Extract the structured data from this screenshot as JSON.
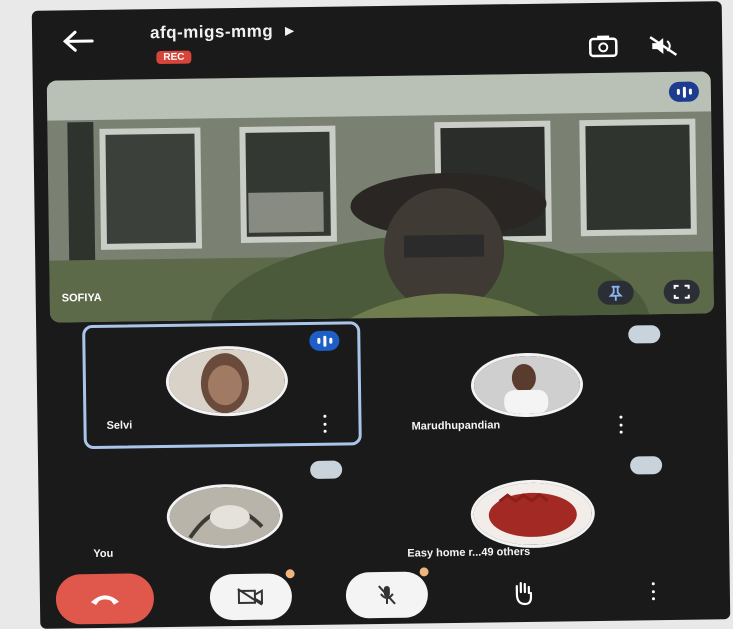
{
  "header": {
    "meeting_code": "afq-migs-mmg",
    "recording_badge": "REC",
    "icons": [
      "back-arrow-icon",
      "caret-right-icon",
      "switch-camera-icon",
      "speaker-off-icon"
    ]
  },
  "main_video": {
    "participant_name": "SOFIYA",
    "badges": [
      "speaking-indicator-icon"
    ],
    "controls": [
      "pin-icon",
      "fullscreen-icon"
    ]
  },
  "participants": [
    {
      "name": "Selvi",
      "state": "speaking",
      "highlighted": true
    },
    {
      "name": "Marudhupandian",
      "state": "muted"
    },
    {
      "name": "You",
      "state": "muted"
    },
    {
      "name": "Easy home r...49 others",
      "state": "muted"
    }
  ],
  "toolbar": {
    "buttons": [
      "end-call-icon",
      "camera-off-icon",
      "mic-off-icon",
      "raise-hand-icon",
      "more-options-icon"
    ]
  },
  "colors": {
    "background": "#1a1a1a",
    "end_call": "#e0574b",
    "recording": "#d6453a",
    "speaking_badge": "#1e3b8f",
    "active_border": "#a9c6ea"
  }
}
